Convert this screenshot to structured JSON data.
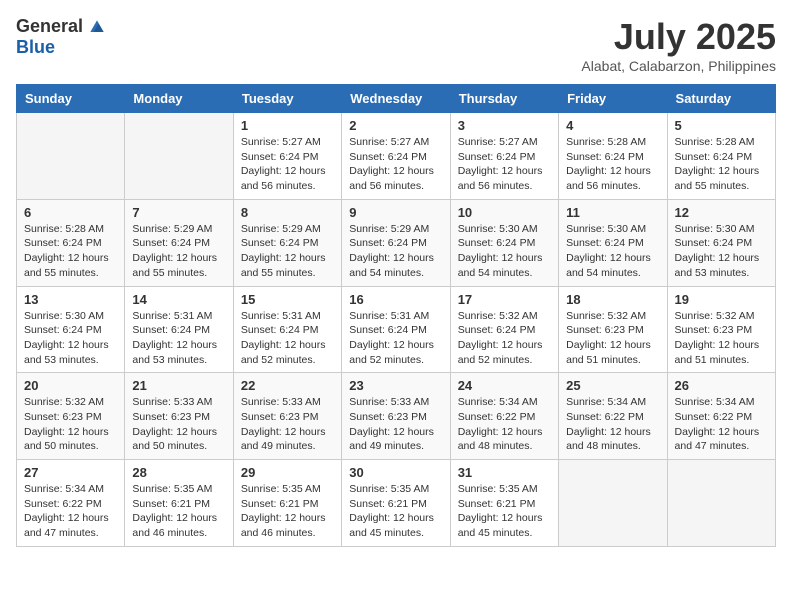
{
  "logo": {
    "general": "General",
    "blue": "Blue"
  },
  "title": {
    "month_year": "July 2025",
    "location": "Alabat, Calabarzon, Philippines"
  },
  "weekdays": [
    "Sunday",
    "Monday",
    "Tuesday",
    "Wednesday",
    "Thursday",
    "Friday",
    "Saturday"
  ],
  "weeks": [
    [
      {
        "day": "",
        "sunrise": "",
        "sunset": "",
        "daylight": ""
      },
      {
        "day": "",
        "sunrise": "",
        "sunset": "",
        "daylight": ""
      },
      {
        "day": "1",
        "sunrise": "Sunrise: 5:27 AM",
        "sunset": "Sunset: 6:24 PM",
        "daylight": "Daylight: 12 hours and 56 minutes."
      },
      {
        "day": "2",
        "sunrise": "Sunrise: 5:27 AM",
        "sunset": "Sunset: 6:24 PM",
        "daylight": "Daylight: 12 hours and 56 minutes."
      },
      {
        "day": "3",
        "sunrise": "Sunrise: 5:27 AM",
        "sunset": "Sunset: 6:24 PM",
        "daylight": "Daylight: 12 hours and 56 minutes."
      },
      {
        "day": "4",
        "sunrise": "Sunrise: 5:28 AM",
        "sunset": "Sunset: 6:24 PM",
        "daylight": "Daylight: 12 hours and 56 minutes."
      },
      {
        "day": "5",
        "sunrise": "Sunrise: 5:28 AM",
        "sunset": "Sunset: 6:24 PM",
        "daylight": "Daylight: 12 hours and 55 minutes."
      }
    ],
    [
      {
        "day": "6",
        "sunrise": "Sunrise: 5:28 AM",
        "sunset": "Sunset: 6:24 PM",
        "daylight": "Daylight: 12 hours and 55 minutes."
      },
      {
        "day": "7",
        "sunrise": "Sunrise: 5:29 AM",
        "sunset": "Sunset: 6:24 PM",
        "daylight": "Daylight: 12 hours and 55 minutes."
      },
      {
        "day": "8",
        "sunrise": "Sunrise: 5:29 AM",
        "sunset": "Sunset: 6:24 PM",
        "daylight": "Daylight: 12 hours and 55 minutes."
      },
      {
        "day": "9",
        "sunrise": "Sunrise: 5:29 AM",
        "sunset": "Sunset: 6:24 PM",
        "daylight": "Daylight: 12 hours and 54 minutes."
      },
      {
        "day": "10",
        "sunrise": "Sunrise: 5:30 AM",
        "sunset": "Sunset: 6:24 PM",
        "daylight": "Daylight: 12 hours and 54 minutes."
      },
      {
        "day": "11",
        "sunrise": "Sunrise: 5:30 AM",
        "sunset": "Sunset: 6:24 PM",
        "daylight": "Daylight: 12 hours and 54 minutes."
      },
      {
        "day": "12",
        "sunrise": "Sunrise: 5:30 AM",
        "sunset": "Sunset: 6:24 PM",
        "daylight": "Daylight: 12 hours and 53 minutes."
      }
    ],
    [
      {
        "day": "13",
        "sunrise": "Sunrise: 5:30 AM",
        "sunset": "Sunset: 6:24 PM",
        "daylight": "Daylight: 12 hours and 53 minutes."
      },
      {
        "day": "14",
        "sunrise": "Sunrise: 5:31 AM",
        "sunset": "Sunset: 6:24 PM",
        "daylight": "Daylight: 12 hours and 53 minutes."
      },
      {
        "day": "15",
        "sunrise": "Sunrise: 5:31 AM",
        "sunset": "Sunset: 6:24 PM",
        "daylight": "Daylight: 12 hours and 52 minutes."
      },
      {
        "day": "16",
        "sunrise": "Sunrise: 5:31 AM",
        "sunset": "Sunset: 6:24 PM",
        "daylight": "Daylight: 12 hours and 52 minutes."
      },
      {
        "day": "17",
        "sunrise": "Sunrise: 5:32 AM",
        "sunset": "Sunset: 6:24 PM",
        "daylight": "Daylight: 12 hours and 52 minutes."
      },
      {
        "day": "18",
        "sunrise": "Sunrise: 5:32 AM",
        "sunset": "Sunset: 6:23 PM",
        "daylight": "Daylight: 12 hours and 51 minutes."
      },
      {
        "day": "19",
        "sunrise": "Sunrise: 5:32 AM",
        "sunset": "Sunset: 6:23 PM",
        "daylight": "Daylight: 12 hours and 51 minutes."
      }
    ],
    [
      {
        "day": "20",
        "sunrise": "Sunrise: 5:32 AM",
        "sunset": "Sunset: 6:23 PM",
        "daylight": "Daylight: 12 hours and 50 minutes."
      },
      {
        "day": "21",
        "sunrise": "Sunrise: 5:33 AM",
        "sunset": "Sunset: 6:23 PM",
        "daylight": "Daylight: 12 hours and 50 minutes."
      },
      {
        "day": "22",
        "sunrise": "Sunrise: 5:33 AM",
        "sunset": "Sunset: 6:23 PM",
        "daylight": "Daylight: 12 hours and 49 minutes."
      },
      {
        "day": "23",
        "sunrise": "Sunrise: 5:33 AM",
        "sunset": "Sunset: 6:23 PM",
        "daylight": "Daylight: 12 hours and 49 minutes."
      },
      {
        "day": "24",
        "sunrise": "Sunrise: 5:34 AM",
        "sunset": "Sunset: 6:22 PM",
        "daylight": "Daylight: 12 hours and 48 minutes."
      },
      {
        "day": "25",
        "sunrise": "Sunrise: 5:34 AM",
        "sunset": "Sunset: 6:22 PM",
        "daylight": "Daylight: 12 hours and 48 minutes."
      },
      {
        "day": "26",
        "sunrise": "Sunrise: 5:34 AM",
        "sunset": "Sunset: 6:22 PM",
        "daylight": "Daylight: 12 hours and 47 minutes."
      }
    ],
    [
      {
        "day": "27",
        "sunrise": "Sunrise: 5:34 AM",
        "sunset": "Sunset: 6:22 PM",
        "daylight": "Daylight: 12 hours and 47 minutes."
      },
      {
        "day": "28",
        "sunrise": "Sunrise: 5:35 AM",
        "sunset": "Sunset: 6:21 PM",
        "daylight": "Daylight: 12 hours and 46 minutes."
      },
      {
        "day": "29",
        "sunrise": "Sunrise: 5:35 AM",
        "sunset": "Sunset: 6:21 PM",
        "daylight": "Daylight: 12 hours and 46 minutes."
      },
      {
        "day": "30",
        "sunrise": "Sunrise: 5:35 AM",
        "sunset": "Sunset: 6:21 PM",
        "daylight": "Daylight: 12 hours and 45 minutes."
      },
      {
        "day": "31",
        "sunrise": "Sunrise: 5:35 AM",
        "sunset": "Sunset: 6:21 PM",
        "daylight": "Daylight: 12 hours and 45 minutes."
      },
      {
        "day": "",
        "sunrise": "",
        "sunset": "",
        "daylight": ""
      },
      {
        "day": "",
        "sunrise": "",
        "sunset": "",
        "daylight": ""
      }
    ]
  ]
}
